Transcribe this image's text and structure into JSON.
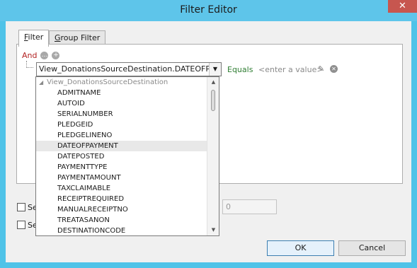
{
  "window": {
    "title": "Filter Editor",
    "close_glyph": "✕",
    "accent_color": "#5ec5ea",
    "close_color": "#c7564f"
  },
  "tabs": [
    {
      "accel": "F",
      "rest": "ilter",
      "active": true
    },
    {
      "accel": "G",
      "rest": "roup Filter",
      "active": false
    }
  ],
  "filter": {
    "group_operator": "And",
    "add_icon": "plus-circle-icon",
    "group_menu_icon": "ellipsis-circle-icon",
    "field_value": "View_DonationsSourceDestination.DATEOFPA...",
    "operator": "Equals",
    "value_placeholder": "<enter a value>",
    "operator_color": "#2e7d32",
    "group_color": "#b22222"
  },
  "dropdown": {
    "group": "View_DonationsSourceDestination",
    "items": [
      "ADMITNAME",
      "AUTOID",
      "SERIALNUMBER",
      "PLEDGEID",
      "PLEDGELINENO",
      "DATEOFPAYMENT",
      "DATEPOSTED",
      "PAYMENTTYPE",
      "PAYMENTAMOUNT",
      "TAXCLAIMABLE",
      "RECEIPTREQUIRED",
      "MANUALRECEIPTNO",
      "TREATASANON",
      "DESTINATIONCODE"
    ],
    "selected_index": 5
  },
  "options": {
    "checkbox1_label": "Se",
    "checkbox2_label": "Se",
    "number_value": "0"
  },
  "buttons": {
    "ok": "OK",
    "cancel": "Cancel"
  }
}
